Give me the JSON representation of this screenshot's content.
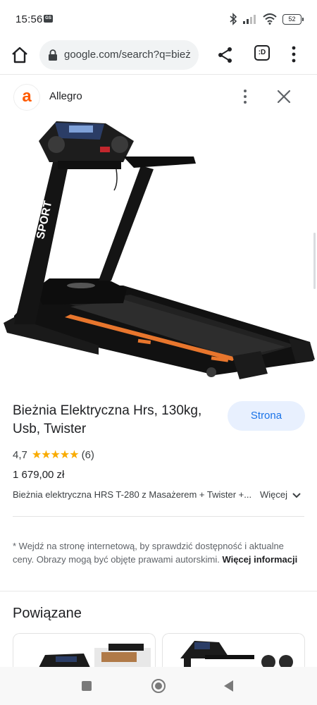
{
  "status_bar": {
    "time": "15:56",
    "carrier_badge": "GS",
    "battery": "52",
    "icons": [
      "bluetooth-icon",
      "signal-icon",
      "wifi-icon",
      "battery-icon"
    ]
  },
  "browser": {
    "url": "google.com/search?q=bież",
    "icons": [
      "home-icon",
      "lock-icon",
      "share-icon",
      "menu-icon"
    ],
    "tabs_label": ":D"
  },
  "source": {
    "logo_letter": "a",
    "name": "Allegro",
    "brand_color": "#ff5a00"
  },
  "image": {
    "brand_text": "SPORT",
    "accent_color": "#e8762d"
  },
  "product": {
    "title": "Bieżnia Elektryczna Hrs, 130kg, Usb, Twister",
    "visit_button": "Strona",
    "rating": "4,7",
    "rating_value": 4.7,
    "stars": "★★★★★",
    "review_count": "(6)",
    "price": "1 679,00 zł",
    "description": "Bieżnia elektryczna HRS T-280 z Masażerem + Twister +...",
    "description_more": "Więcej"
  },
  "disclaimer": {
    "text": "* Wejdź na stronę internetową, by sprawdzić dostępność i aktualne ceny. Obrazy mogą być objęte prawami autorskimi. ",
    "link": "Więcej informacji"
  },
  "related": {
    "heading": "Powiązane"
  }
}
